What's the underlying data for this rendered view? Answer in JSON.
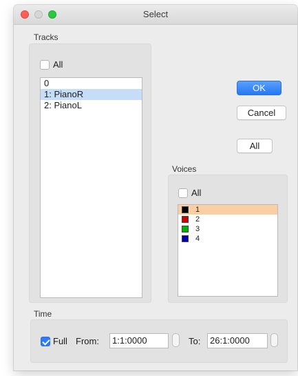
{
  "window": {
    "title": "Select"
  },
  "tracks": {
    "label": "Tracks",
    "all_label": "All",
    "all_checked": false,
    "items": [
      "0",
      "1: PianoR",
      "2: PianoL"
    ],
    "selected_index": 1
  },
  "buttons": {
    "ok": "OK",
    "cancel": "Cancel",
    "all": "All"
  },
  "voices": {
    "label": "Voices",
    "all_label": "All",
    "all_checked": false,
    "items": [
      {
        "label": "1",
        "color": "#000000"
      },
      {
        "label": "2",
        "color": "#d10000"
      },
      {
        "label": "3",
        "color": "#00b300"
      },
      {
        "label": "4",
        "color": "#0000b3"
      }
    ],
    "selected_index": 0
  },
  "time": {
    "label": "Time",
    "full_label": "Full",
    "full_checked": true,
    "from_label": "From:",
    "from_value": "1:1:0000",
    "to_label": "To:",
    "to_value": "26:1:0000"
  },
  "colors": {
    "accent": "#2f7cf6",
    "selection_blue": "#c6ddf7",
    "selection_orange": "#f9cfa3"
  }
}
